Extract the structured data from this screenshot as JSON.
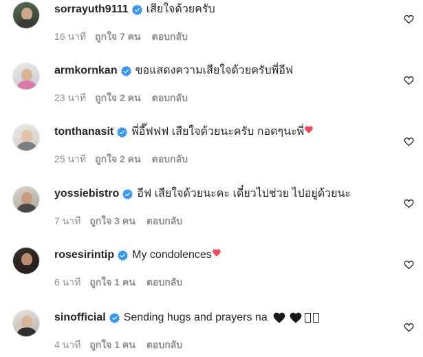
{
  "colors": {
    "verified_blue": "#3897f0",
    "meta_gray": "#8e8e8e",
    "heart_red": "#ed4956",
    "text": "#262626"
  },
  "comments": [
    {
      "username": "sorrayuth9111",
      "verified": true,
      "text": "เสียใจด้วยครับ",
      "time": "16 นาที",
      "likes": "ถูกใจ 7 คน",
      "reply": "ตอบกลับ",
      "avatar_icon": "profile-photo"
    },
    {
      "username": "armkornkan",
      "verified": true,
      "text": "ขอแสดงความเสียใจด้วยครับพี่อีฟ",
      "time": "23 นาที",
      "likes": "ถูกใจ 2 คน",
      "reply": "ตอบกลับ",
      "avatar_icon": "profile-photo"
    },
    {
      "username": "tonthanasit",
      "verified": true,
      "text": "พี่อี๊ฟฟฟ เสียใจด้วยนะครับ กอดๆนะพี่",
      "emoji": "red-heart",
      "time": "25 นาที",
      "likes": "ถูกใจ 2 คน",
      "reply": "ตอบกลับ",
      "avatar_icon": "profile-photo"
    },
    {
      "username": "yossiebistro",
      "verified": true,
      "text": "อีฟ เสียใจด้วยนะคะ เดี๋ยวไปช่วย ไปอยู่ด้วยนะ",
      "time": "7 นาที",
      "likes": "ถูกใจ 3 คน",
      "reply": "ตอบกลับ",
      "avatar_icon": "profile-photo"
    },
    {
      "username": "rosesirintip",
      "verified": true,
      "text": "My condolences",
      "emoji": "red-heart",
      "time": "6 นาที",
      "likes": "ถูกใจ 1 คน",
      "reply": "ตอบกลับ",
      "avatar_icon": "profile-photo"
    },
    {
      "username": "sinofficial",
      "verified": true,
      "text": "Sending hugs and prayers na",
      "emoji": "black-hearts",
      "time": "4 นาที",
      "likes": "ถูกใจ 1 คน",
      "reply": "ตอบกลับ",
      "avatar_icon": "profile-photo"
    }
  ]
}
